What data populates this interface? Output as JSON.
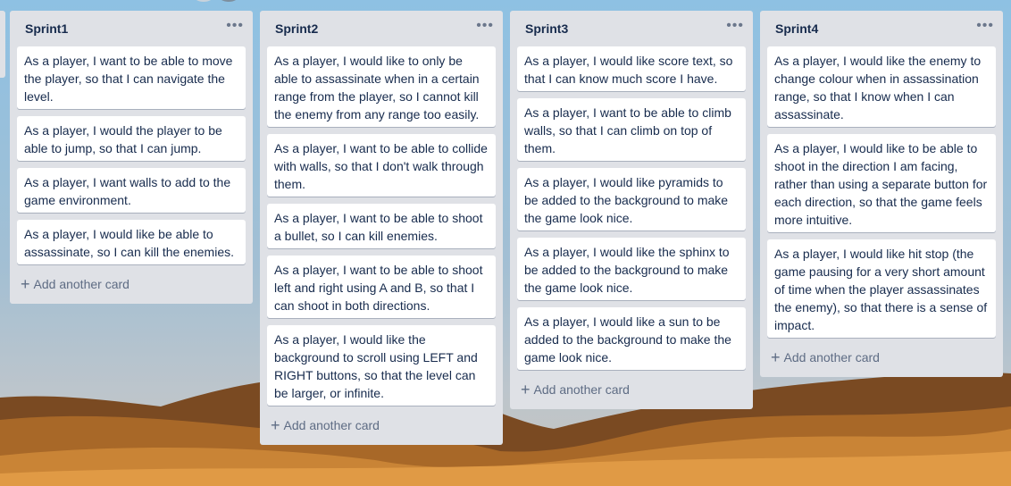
{
  "board": {
    "add_card_label": "Add another card",
    "lists": [
      {
        "title": "Sprint1",
        "cards": [
          "As a player, I want to be able to move the player, so that I can navigate the level.",
          "As a player, I would the player to be able to jump, so that I can jump.",
          "As a player, I want walls to add to the game environment.",
          "As a player, I would like be able to assassinate, so I can kill the enemies."
        ]
      },
      {
        "title": "Sprint2",
        "cards": [
          "As a player, I would like to only be able to assassinate when in a certain range from the player, so I cannot kill the enemy from any range too easily.",
          "As a player, I want to be able to collide with walls, so that I don't walk through them.",
          "As a player, I want to be able to shoot a bullet, so I can kill enemies.",
          "As a player, I want to be able to shoot left and right using A and B, so that I can shoot in both directions.",
          "As a player, I would like the background to scroll using LEFT and RIGHT buttons, so that the level can be larger, or infinite."
        ]
      },
      {
        "title": "Sprint3",
        "cards": [
          "As a player, I would like score text, so that I can know much score I have.",
          "As a player, I want to be able to climb walls, so that I can climb on top of them.",
          "As a player, I would like pyramids to be added to the background to make the game look nice.",
          "As a player, I would like the sphinx to be added to the background to make the game look nice.",
          "As a player, I would like a sun to be added to the background to make the game look nice."
        ]
      },
      {
        "title": "Sprint4",
        "cards": [
          "As a player, I would like the enemy to change colour when in assassination range, so that I know when I can assassinate.",
          "As a player, I would like to be able to shoot in the direction I am facing, rather than using a separate button for each direction, so that the game feels more intuitive.",
          "As a player, I would like hit stop (the game pausing for a very short amount of time when the player assassinates the enemy), so that there is a sense of impact."
        ]
      }
    ]
  }
}
